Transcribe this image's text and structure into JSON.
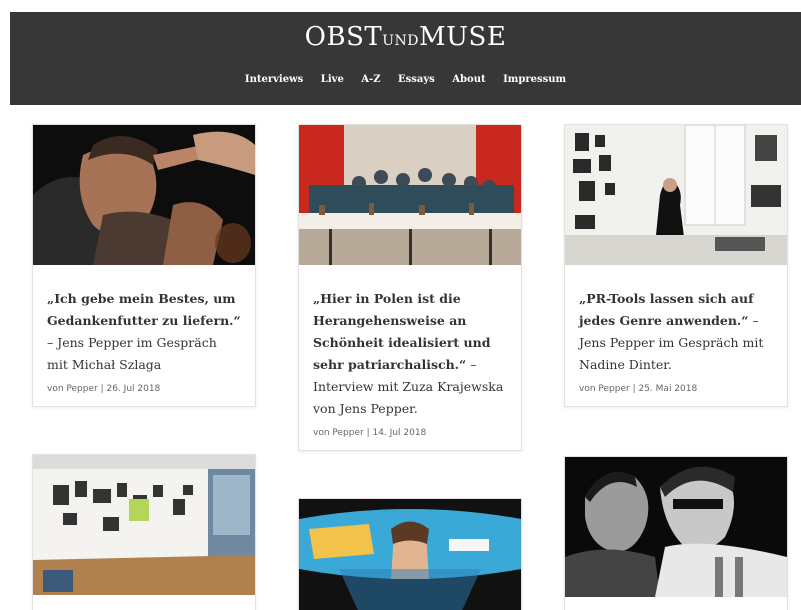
{
  "site": {
    "logo_part1": "OBST",
    "logo_part2": "UND",
    "logo_part3": "MUSE",
    "nav": [
      "Interviews",
      "Live",
      "A-Z",
      "Essays",
      "About",
      "Impressum"
    ]
  },
  "posts": [
    {
      "title_bold": "„Ich gebe mein Bestes, um Gedankenfutter zu liefern.“",
      "title_rest": " – Jens Pepper im Gespräch mit Michał Szlaga",
      "author": "Pepper",
      "date": "26. Jul 2018"
    },
    {
      "title_bold": "„Hier in Polen ist die Herangehensweise an Schönheit idealisiert und sehr patriarchalisch.“",
      "title_rest": " – Interview mit Zuza Krajewska von Jens Pepper.",
      "author": "Pepper",
      "date": "14. Jul 2018"
    },
    {
      "title_bold": "„PR-Tools lassen sich auf jedes Genre anwenden.“",
      "title_rest": " – Jens Pepper im Gespräch mit Nadine Dinter.",
      "author": "Pepper",
      "date": "25. Mai 2018"
    }
  ],
  "meta_prefix": "von ",
  "meta_sep": " | ",
  "colors": {
    "header_bg": "#373737",
    "text": "#333333",
    "meta": "#666666"
  }
}
